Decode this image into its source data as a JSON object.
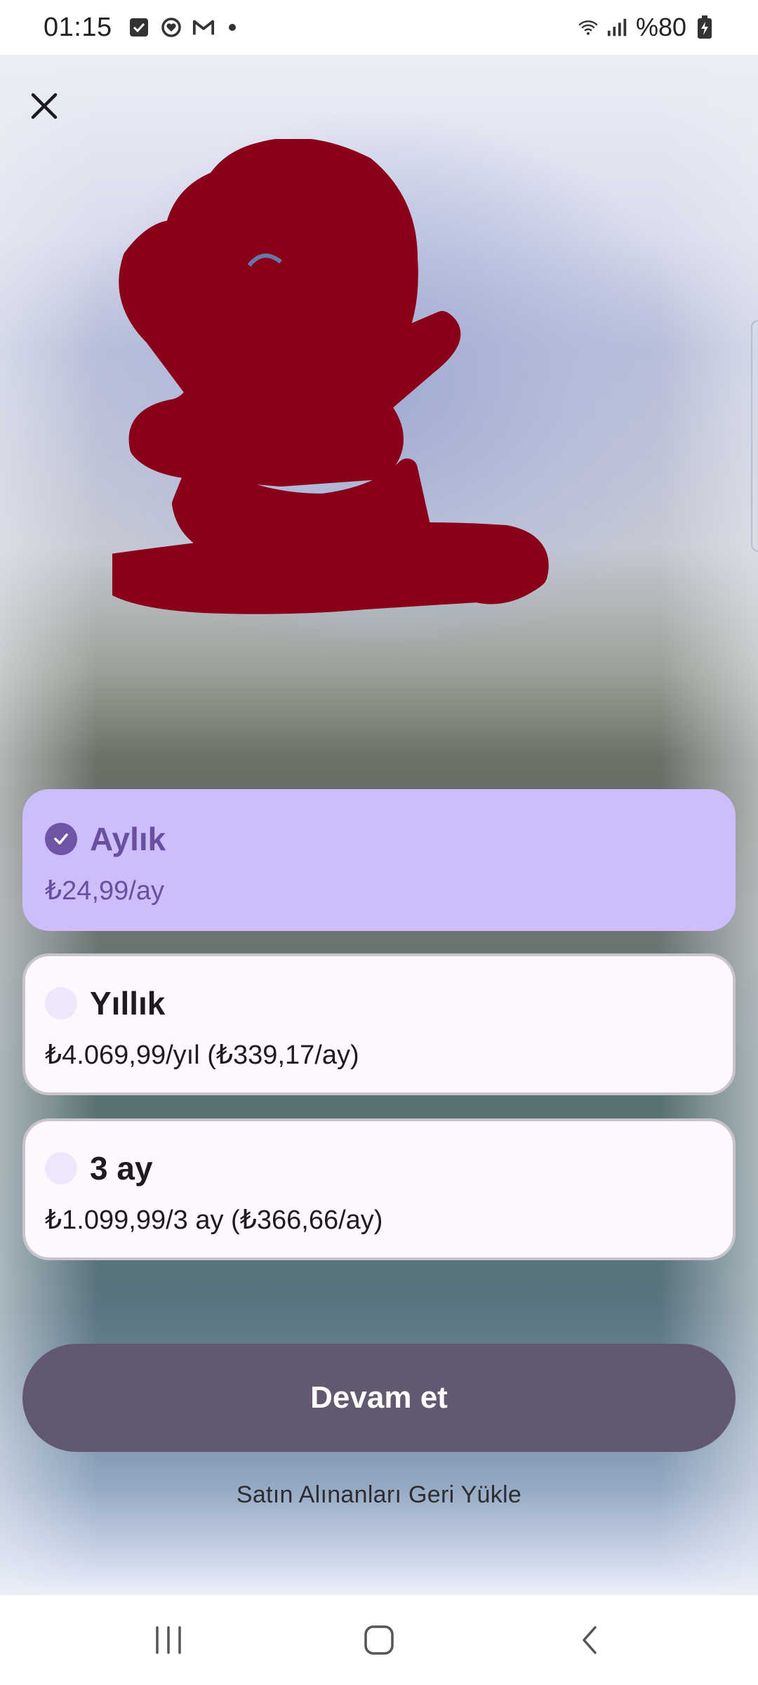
{
  "status_bar": {
    "time": "01:15",
    "battery": "%80",
    "icons": [
      "checkbox-icon",
      "heart-sync-icon",
      "gmail-icon",
      "notification-dot-icon",
      "wifi-icon",
      "signal-icon",
      "battery-charging-icon"
    ]
  },
  "close": {
    "icon": "close-icon"
  },
  "hero": {
    "description_icon": "redacted-scribble-graphic",
    "color": "#8b0019"
  },
  "plans": [
    {
      "name": "Aylık",
      "price": "₺24,99/ay",
      "selected": true
    },
    {
      "name": "Yıllık",
      "price": "₺4.069,99/yıl (₺339,17/ay)",
      "selected": false
    },
    {
      "name": "3 ay",
      "price": "₺1.099,99/3 ay (₺366,66/ay)",
      "selected": false
    }
  ],
  "continue_button": {
    "label": "Devam et",
    "color": "#625870"
  },
  "restore_link": {
    "label": "Satın Alınanları Geri Yükle"
  },
  "nav_bar": {
    "icons": [
      "recent-apps-icon",
      "home-icon",
      "back-icon"
    ]
  },
  "colors": {
    "selected_card": "#cdbdfb",
    "selected_text": "#6a4fa0",
    "unselected_card": "#fdf8fd"
  }
}
